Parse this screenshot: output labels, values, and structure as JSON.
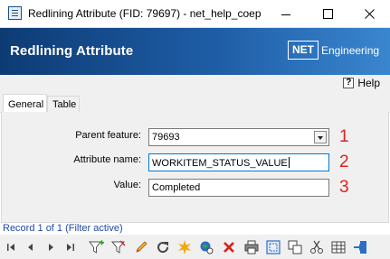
{
  "window": {
    "title": "Redlining Attribute (FID: 79697) - net_help_coep",
    "controls": [
      "minimize-icon",
      "maximize-icon",
      "close-icon"
    ]
  },
  "banner": {
    "title": "Redlining Attribute",
    "logo_box": "NET",
    "logo_text": "Engineering"
  },
  "helpbar": {
    "icon": "?",
    "label": "Help"
  },
  "tabs": [
    {
      "label": "General",
      "active": true
    },
    {
      "label": "Table",
      "active": false
    }
  ],
  "form": {
    "parent_feature": {
      "label": "Parent feature:",
      "value": "79693"
    },
    "attribute_name": {
      "label": "Attribute name:",
      "value": "WORKITEM_STATUS_VALUE"
    },
    "value": {
      "label": "Value:",
      "value": "Completed"
    }
  },
  "annotations": [
    "1",
    "2",
    "3"
  ],
  "record_status": "Record 1 of 1 (Filter active)",
  "toolbar_icons": [
    "first-record-icon",
    "previous-record-icon",
    "next-record-icon",
    "last-record-icon",
    "add-filter-icon",
    "filter-icon",
    "edit-icon",
    "refresh-icon",
    "highlight-icon",
    "zoom-to-icon",
    "delete-icon",
    "print-icon",
    "select-icon",
    "copy-icon",
    "cut-icon",
    "table-icon",
    "exit-icon"
  ],
  "colors": {
    "banner_dark": "#0d3b74",
    "banner_light": "#3a86cf",
    "annotation_red": "#e0201b",
    "record_status_blue": "#1f4aa8",
    "focus_border": "#0078d7"
  }
}
